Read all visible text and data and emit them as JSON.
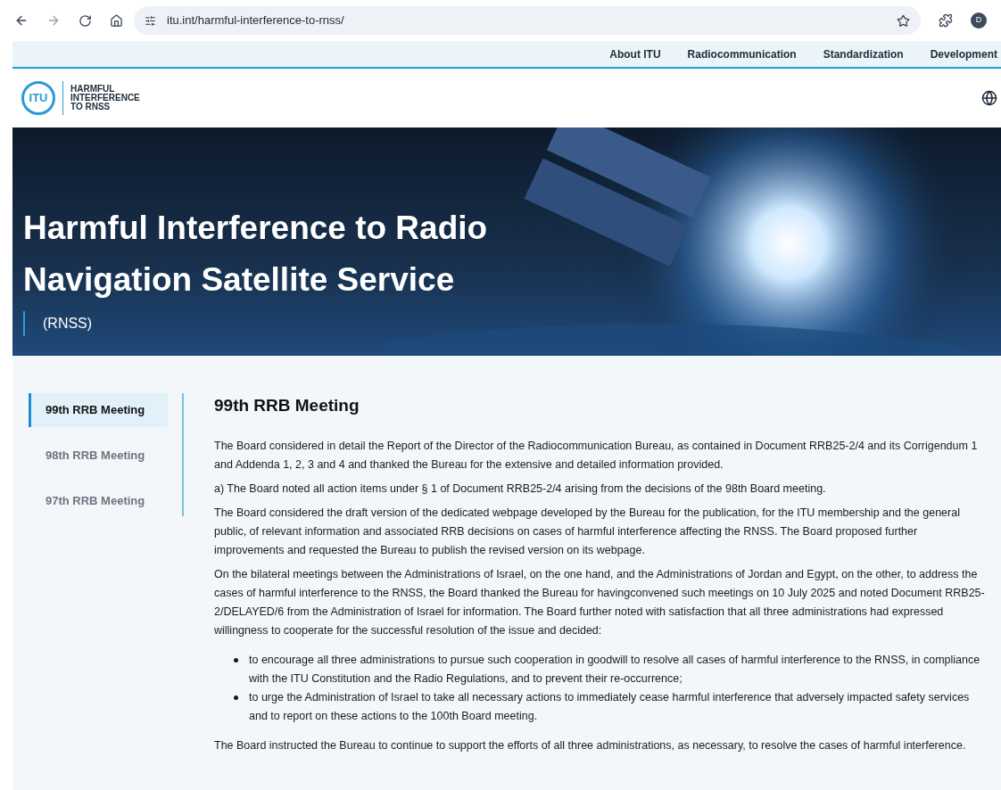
{
  "browser": {
    "url": "itu.int/harmful-interference-to-rnss/",
    "profile": "D"
  },
  "top_nav": [
    "About ITU",
    "Radiocommunication",
    "Standardization",
    "Development"
  ],
  "logo": {
    "mark": "ITU",
    "title": "HARMFUL INTERFERENCE TO RNSS"
  },
  "hero": {
    "title": "Harmful Interference to Radio Navigation Satellite Service",
    "subtitle": "(RNSS)"
  },
  "sidebar": {
    "items": [
      {
        "label": "99th RRB Meeting",
        "selected": true
      },
      {
        "label": "98th RRB Meeting",
        "selected": false
      },
      {
        "label": "97th RRB Meeting",
        "selected": false
      }
    ]
  },
  "article": {
    "heading": "99th RRB Meeting",
    "blocks": [
      {
        "kind": "paragraph",
        "text": "The Board considered in detail the Report of the Director of the Radiocommunication Bureau, as contained in Document RRB25-2/4 and its Corrigendum 1 and Addenda 1, 2, 3 and 4 and thanked the Bureau for the extensive and detailed information provided."
      },
      {
        "kind": "paragraph",
        "text": "a) The Board noted all action items under § 1 of Document RRB25-2/4 arising from the decisions of the 98th Board meeting."
      },
      {
        "kind": "paragraph",
        "text": "The Board considered the draft version of the dedicated webpage developed by the Bureau for the publication, for the ITU membership and the general public, of relevant information and associated RRB decisions on cases of harmful interference affecting the RNSS. The Board proposed further improvements and requested the Bureau to publish the revised version on its webpage."
      },
      {
        "kind": "paragraph",
        "text": "On the bilateral meetings between the Administrations of Israel, on the one hand, and the Administrations of Jordan and Egypt, on the other, to address the cases of harmful interference to the RNSS, the Board thanked the Bureau for havingconvened such meetings on 10 July 2025 and noted Document RRB25-2/DELAYED/6  from the Administration of Israel for information.  The Board further noted with satisfaction that all three administrations had expressed willingness to cooperate for the successful resolution of the issue and decided:"
      },
      {
        "kind": "list",
        "items": [
          "to encourage all three administrations to pursue such cooperation in goodwill to resolve all cases of harmful interference to the RNSS, in compliance with the ITU Constitution and the Radio Regulations, and to prevent their re-occurrence;",
          "to urge the Administration of Israel to take all necessary actions to immediately cease harmful interference that adversely impacted safety services and to report on these actions to the 100th Board meeting."
        ]
      },
      {
        "kind": "paragraph",
        "text": "The Board instructed the Bureau to continue to support the efforts of all three administrations, as necessary, to resolve the cases of harmful interference."
      }
    ]
  }
}
